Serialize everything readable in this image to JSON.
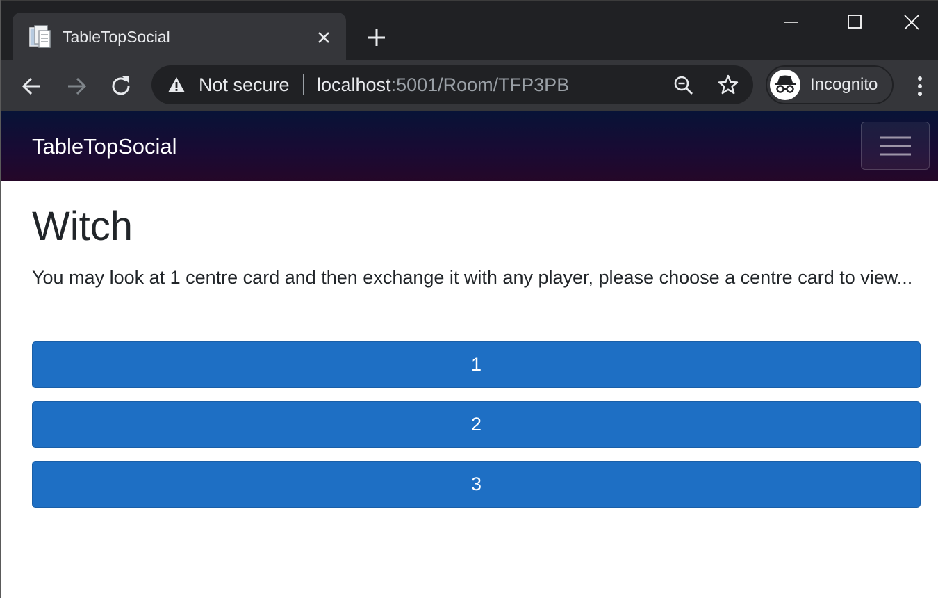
{
  "browser": {
    "tab_title": "TableTopSocial",
    "security_label": "Not secure",
    "url_host": "localhost",
    "url_rest": ":5001/Room/TFP3PB",
    "profile_label": "Incognito"
  },
  "navbar": {
    "brand": "TableTopSocial"
  },
  "main": {
    "title": "Witch",
    "instructions": "You may look at 1 centre card and then exchange it with any player, please choose a centre card to view...",
    "card_buttons": [
      {
        "label": "1"
      },
      {
        "label": "2"
      },
      {
        "label": "3"
      }
    ]
  },
  "colors": {
    "button_primary": "#1e6fc4",
    "navbar_top": "#081337",
    "navbar_bottom": "#250728",
    "chrome_dark": "#202124",
    "chrome_toolbar": "#35363a"
  },
  "icons": [
    "document-icon",
    "close-icon",
    "plus-icon",
    "minimize-icon",
    "maximize-icon",
    "window-close-icon",
    "back-arrow-icon",
    "forward-arrow-icon",
    "reload-icon",
    "warning-icon",
    "zoom-out-icon",
    "star-icon",
    "incognito-icon",
    "kebab-menu-icon",
    "hamburger-menu-icon"
  ]
}
